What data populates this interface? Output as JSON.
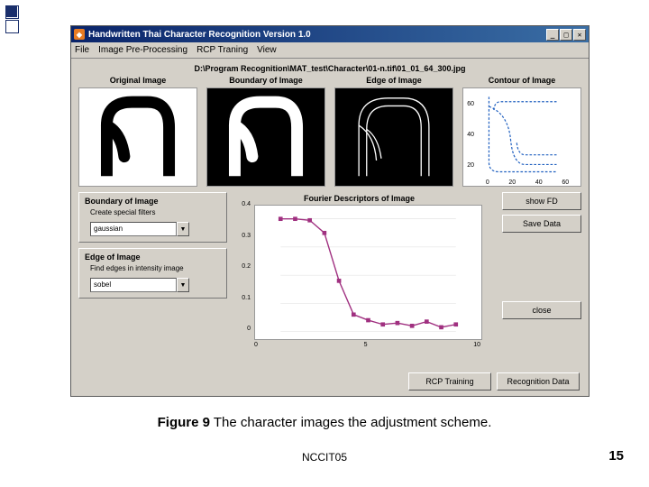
{
  "decoration": {
    "bullets": [
      "solid",
      "outline"
    ]
  },
  "window": {
    "title": "Handwritten Thai Character Recognition Version 1.0",
    "icon_glyph": "◆",
    "controls": {
      "min": "_",
      "max": "□",
      "close": "✕"
    },
    "menus": [
      "File",
      "Image Pre-Processing",
      "RCP Traning",
      "View"
    ]
  },
  "path_text": "D:\\Program Recognition\\MAT_test\\Character\\01-n.tif\\01_01_64_300.jpg",
  "image_row": {
    "original": {
      "title": "Original Image"
    },
    "boundary": {
      "title": "Boundary of Image"
    },
    "edge": {
      "title": "Edge of Image"
    },
    "contour": {
      "title": "Contour of Image",
      "y_ticks": [
        "20",
        "40",
        "60"
      ],
      "x_ticks": [
        "0",
        "20",
        "40",
        "60"
      ]
    }
  },
  "panel_boundary": {
    "title": "Boundary of Image",
    "sub": "Create special filters",
    "select_value": "gaussian"
  },
  "panel_edge": {
    "title": "Edge of Image",
    "sub": "Find edges in intensity image",
    "select_value": "sobel"
  },
  "fd": {
    "title": "Fourier Descriptors of Image",
    "y_ticks": [
      "0",
      "0.1",
      "0.2",
      "0.3",
      "0.4"
    ],
    "x_ticks": [
      "0",
      "5",
      "10"
    ]
  },
  "buttons": {
    "show_fd": "show FD",
    "save_data": "Save Data",
    "close": "close",
    "rcp": "RCP Training",
    "recog": "Recognition Data"
  },
  "caption": {
    "label": "Figure 9",
    "text": " The character images the adjustment scheme."
  },
  "footer": "NCCIT05",
  "page_number": "15",
  "chart_data": {
    "type": "line",
    "title": "Fourier Descriptors of Image",
    "xlabel": "",
    "ylabel": "",
    "x": [
      0,
      1,
      2,
      3,
      4,
      5,
      6,
      7,
      8,
      9,
      10,
      11,
      12
    ],
    "values": [
      0.4,
      0.4,
      0.395,
      0.35,
      0.18,
      0.06,
      0.04,
      0.025,
      0.03,
      0.02,
      0.035,
      0.015,
      0.025
    ],
    "xlim": [
      0,
      12
    ],
    "ylim": [
      0,
      0.42
    ]
  }
}
